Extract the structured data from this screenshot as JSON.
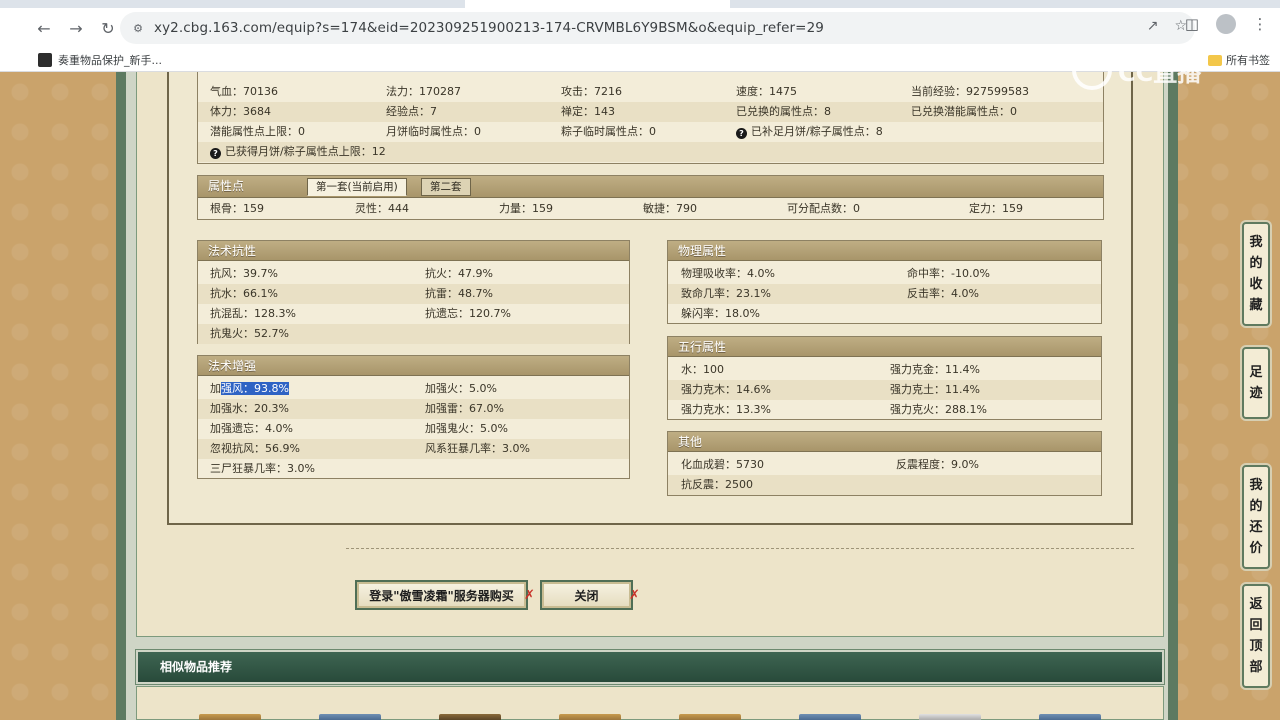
{
  "browser": {
    "url": "xy2.cbg.163.com/equip?s=174&eid=202309251900213-174-CRVMBL6Y9BSM&o&equip_refer=29",
    "bookmark": "奏重物品保护_新手...",
    "all_bookmarks": "所有书签"
  },
  "watermark": "CC直播",
  "stats": {
    "rows": [
      [
        "气血：70136",
        "法力：170287",
        "攻击：7216",
        "速度：1475",
        "当前经验：927599583"
      ],
      [
        "体力：3684",
        "经验点：7",
        "禅定：143",
        "已兑换的属性点：8",
        "已兑换潜能属性点：0"
      ],
      [
        "潜能属性点上限：0",
        "月饼临时属性点：0",
        "粽子临时属性点：0",
        "已补足月饼/粽子属性点：8",
        ""
      ],
      [
        "已获得月饼/粽子属性点上限：12",
        "",
        "",
        "",
        ""
      ]
    ]
  },
  "attr": {
    "title": "属性点",
    "tab1": "第一套(当前启用)",
    "tab2": "第二套",
    "values": [
      "根骨：159",
      "灵性：444",
      "力量：159",
      "敏捷：790",
      "可分配点数：0",
      "定力：159"
    ]
  },
  "resist": {
    "title": "法术抗性",
    "rows": [
      [
        "抗风：39.7%",
        "抗火：47.9%"
      ],
      [
        "抗水：66.1%",
        "抗雷：48.7%"
      ],
      [
        "抗混乱：128.3%",
        "抗遗忘：120.7%"
      ],
      [
        "抗鬼火：52.7%",
        ""
      ]
    ]
  },
  "enhance": {
    "title": "法术增强",
    "first_prefix": "加",
    "first_highlight": "强风：93.8%",
    "rows": [
      [
        "",
        "加强火：5.0%"
      ],
      [
        "加强水：20.3%",
        "加强雷：67.0%"
      ],
      [
        "加强遗忘：4.0%",
        "加强鬼火：5.0%"
      ],
      [
        "忽视抗风：56.9%",
        "风系狂暴几率：3.0%"
      ],
      [
        "三尸狂暴几率：3.0%",
        ""
      ]
    ]
  },
  "physical": {
    "title": "物理属性",
    "rows": [
      [
        "物理吸收率：4.0%",
        "命中率：-10.0%"
      ],
      [
        "致命几率：23.1%",
        "反击率：4.0%"
      ],
      [
        "躲闪率：18.0%",
        ""
      ]
    ]
  },
  "elements": {
    "title": "五行属性",
    "rows": [
      [
        "水：100",
        "强力克金：11.4%"
      ],
      [
        "强力克木：14.6%",
        "强力克土：11.4%"
      ],
      [
        "强力克水：13.3%",
        "强力克火：288.1%"
      ]
    ]
  },
  "other": {
    "title": "其他",
    "rows": [
      [
        "化血成碧：5730",
        "反震程度：9.0%"
      ],
      [
        "抗反震：2500",
        ""
      ]
    ]
  },
  "buttons": {
    "login": "登录\"傲雪凌霜\"服务器购买",
    "close": "关闭",
    "x_mark": "✗"
  },
  "recommend": {
    "title": "相似物品推荐"
  },
  "side_nav": {
    "favorites": [
      "我",
      "的",
      "收",
      "藏"
    ],
    "footprint": [
      "足",
      "迹"
    ],
    "bargain": [
      "我",
      "的",
      "还",
      "价"
    ],
    "top": [
      "返",
      "回",
      "顶",
      "部"
    ]
  }
}
